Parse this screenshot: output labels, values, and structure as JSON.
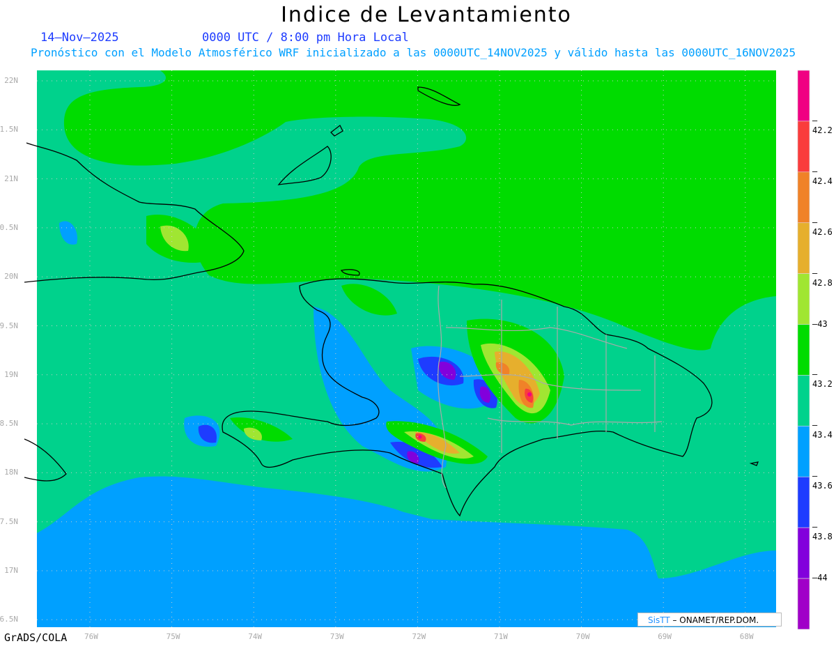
{
  "header": {
    "title": "Indice de Levantamiento",
    "date": "14–Nov–2025",
    "time": "0000 UTC / 8:00 pm Hora Local",
    "subtitle": "Pronóstico con el Modelo Atmosférico WRF inicializado a las 0000UTC_14NOV2025 y válido hasta las  0000UTC_16NOV2025"
  },
  "map": {
    "lat_labels": [
      "22N",
      "1.5N",
      "21N",
      "0.5N",
      "20N",
      "9.5N",
      "19N",
      "8.5N",
      "18N",
      "7.5N",
      "17N",
      "6.5N"
    ],
    "lon_labels": [
      "76W",
      "75W",
      "74W",
      "73W",
      "72W",
      "71W",
      "70W",
      "69W",
      "68W"
    ],
    "grid": "dotted"
  },
  "colorbar": {
    "colors": [
      "#f00082",
      "#fa3c3c",
      "#f08228",
      "#e6af2d",
      "#a0e632",
      "#00dc00",
      "#00d28c",
      "#00a0ff",
      "#1e3cff",
      "#8200dc",
      "#a000c8"
    ],
    "labels": [
      "-42.2",
      "-42.4",
      "-42.6",
      "-42.8",
      "-43",
      "-43.2",
      "-43.4",
      "-43.6",
      "-43.8",
      "-44"
    ]
  },
  "credit": {
    "logo": "SisTT",
    "text": " –  ONAMET/REP.DOM."
  },
  "footer": "GrADS/COLA"
}
